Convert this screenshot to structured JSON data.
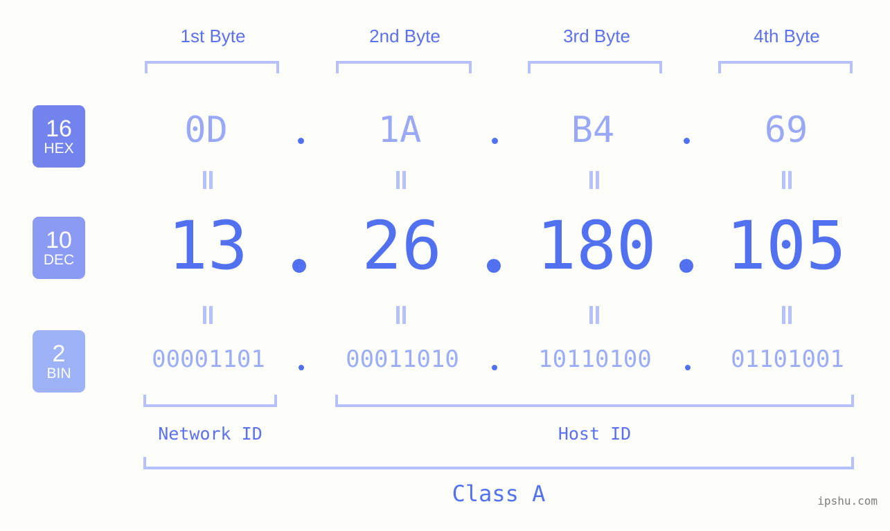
{
  "ip": {
    "dotted_decimal": "13.26.180.105",
    "class": "Class A"
  },
  "columns": [
    {
      "header": "1st Byte",
      "hex": "0D",
      "dec": "13",
      "bin": "00001101"
    },
    {
      "header": "2nd Byte",
      "hex": "1A",
      "dec": "26",
      "bin": "00011010"
    },
    {
      "header": "3rd Byte",
      "hex": "B4",
      "dec": "180",
      "bin": "10110100"
    },
    {
      "header": "4th Byte",
      "hex": "69",
      "dec": "105",
      "bin": "01101001"
    }
  ],
  "bases": [
    {
      "number": "16",
      "name": "HEX",
      "color": "#7283ee"
    },
    {
      "number": "10",
      "name": "DEC",
      "color": "#8b9bf4"
    },
    {
      "number": "2",
      "name": "BIN",
      "color": "#9db2f7"
    }
  ],
  "separator": ".",
  "equality_mark": "||",
  "sections": {
    "network_id": "Network ID",
    "host_id": "Host ID",
    "class": "Class A"
  },
  "watermark": "ipshu.com",
  "colors": {
    "background": "#fdfdfa",
    "accent_strong": "#5271f0",
    "accent_header": "#5b71ef",
    "accent_light": "#99a9f6",
    "bracket": "#b6c1fb"
  }
}
